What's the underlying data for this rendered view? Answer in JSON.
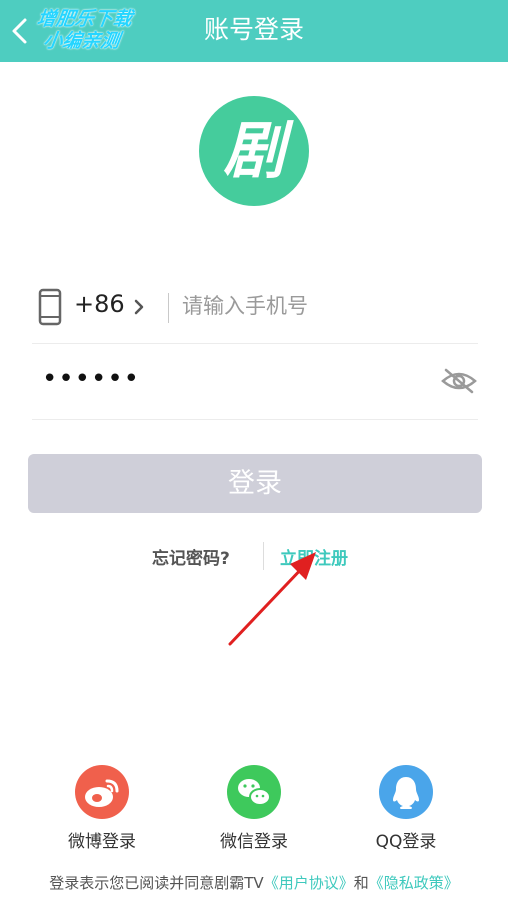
{
  "header": {
    "title": "账号登录",
    "watermark_line1": "增肥乐下载",
    "watermark_line2": "小编亲测"
  },
  "logo": {
    "char": "剧",
    "color": "#45cc9c"
  },
  "phone": {
    "country_code": "+86",
    "placeholder": "请输入手机号",
    "value": ""
  },
  "password": {
    "masked_value": "••••••",
    "visibility": "hidden"
  },
  "login": {
    "label": "登录"
  },
  "links": {
    "forgot": "忘记密码?",
    "register": "立即注册"
  },
  "social": [
    {
      "label": "微博登录",
      "icon": "weibo-icon",
      "color": "#f0604c"
    },
    {
      "label": "微信登录",
      "icon": "wechat-icon",
      "color": "#3ec95c"
    },
    {
      "label": "QQ登录",
      "icon": "qq-icon",
      "color": "#4aa5ea"
    }
  ],
  "agreement": {
    "prefix": "登录表示您已阅读并同意剧霸TV",
    "user_agreement": "《用户协议》",
    "conjunction": "和",
    "privacy_policy": "《隐私政策》"
  },
  "colors": {
    "header": "#4ecdc0",
    "accent": "#3ec9bd",
    "login_button_disabled": "#cfcfd9",
    "annotation_arrow": "#e02020"
  }
}
